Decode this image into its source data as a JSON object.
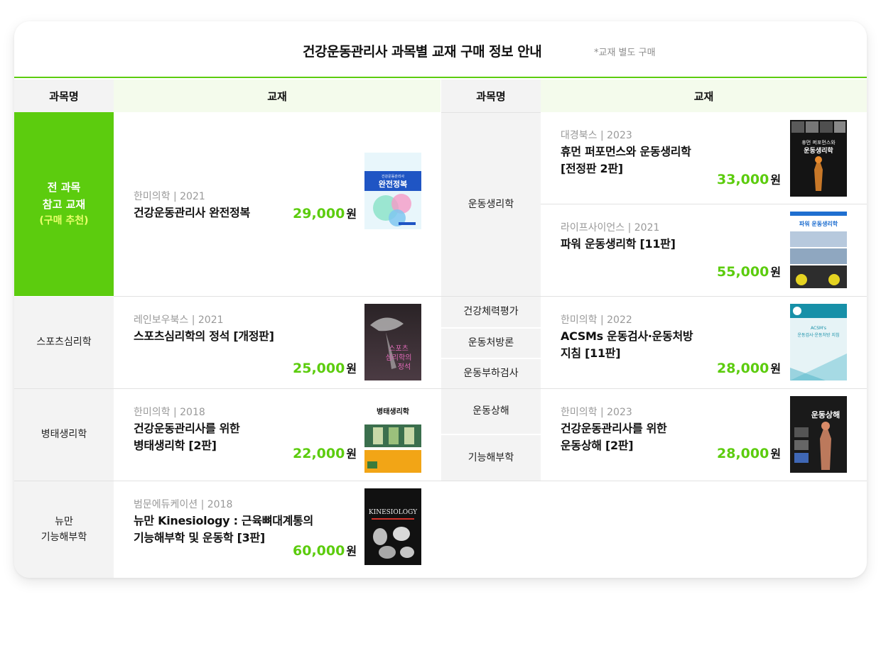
{
  "header": {
    "title": "건강운동관리사 과목별 교재 구매 정보 안내",
    "note": "*교재 별도 구매"
  },
  "columns": {
    "subject": "과목명",
    "book": "교재"
  },
  "rows": {
    "all": {
      "line1": "전 과목",
      "line2": "참고 교재",
      "sub": "(구매 추천)",
      "book": {
        "publisher": "한미의학 | 2021",
        "title": "건강운동관리사 완전정복",
        "price": "29,000",
        "cover_title": "완전정복",
        "cover_top": "건강운동관리사"
      }
    },
    "sports": {
      "subject": "스포츠심리학",
      "book": {
        "publisher": "레인보우북스 | 2021",
        "title": "스포츠심리학의 정석 [개정판]",
        "price": "25,000",
        "cover_title": "스포츠 심리학의 정석"
      }
    },
    "patho": {
      "subject": "병태생리학",
      "book": {
        "publisher": "한미의학 | 2018",
        "title1": "건강운동관리사를 위한",
        "title2": "병태생리학 [2판]",
        "price": "22,000",
        "cover_title": "병태생리학"
      }
    },
    "kines": {
      "subject1": "뉴만",
      "subject2": "기능해부학",
      "book": {
        "publisher": "범문에듀케이션 | 2018",
        "title1": "뉴만 Kinesiology : 근육뼈대계통의",
        "title2": "기능해부학 및 운동학 [3판]",
        "price": "60,000",
        "cover_title": "KINESIOLOGY"
      }
    },
    "exphys": {
      "subject": "운동생리학",
      "book1": {
        "publisher": "대경북스 | 2023",
        "title1": "휴먼 퍼포먼스와 운동생리학",
        "title2": "[전정판 2판]",
        "price": "33,000",
        "cover_title": "휴먼 퍼포먼스와 운동생리학"
      },
      "book2": {
        "publisher": "라이프사이언스 | 2021",
        "title": "파워 운동생리학 [11판]",
        "price": "55,000",
        "cover_title": "파워 운동생리학"
      }
    },
    "acsm": {
      "subjects": [
        "건강체력평가",
        "운동처방론",
        "운동부하검사"
      ],
      "book": {
        "publisher": "한미의학 | 2022",
        "title1": "ACSMs 운동검사·운동처방",
        "title2": "지침 [11판]",
        "price": "28,000",
        "cover_title": "ACSM's 운동검사·운동처방 지침"
      }
    },
    "injury": {
      "subjects": [
        "운동상해",
        "기능해부학"
      ],
      "book": {
        "publisher": "한미의학 | 2023",
        "title1": "건강운동관리사를 위한",
        "title2": "운동상해 [2판]",
        "price": "28,000",
        "cover_title": "운동상해"
      }
    }
  },
  "currency": "원",
  "colors": {
    "accent": "#5ccc0e",
    "highlight": "#e9ff6a",
    "subject_bg": "#f3f3f3",
    "header_green_bg": "#f4fbec"
  }
}
